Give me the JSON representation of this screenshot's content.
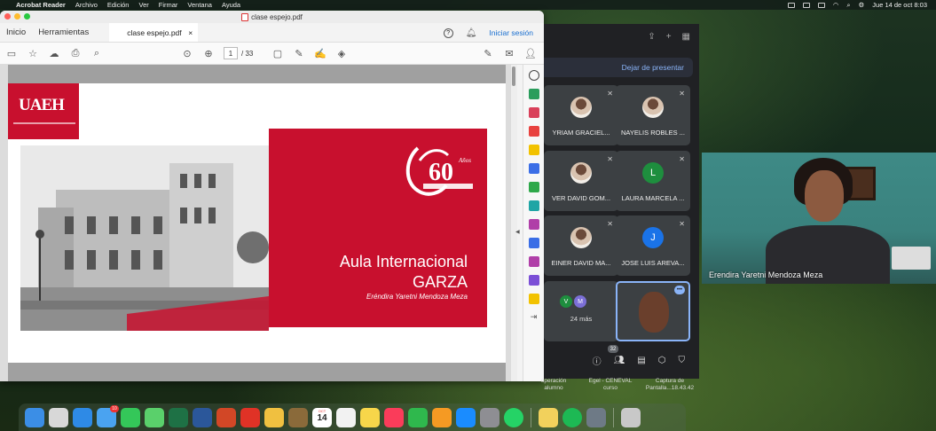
{
  "menubar": {
    "app": "Acrobat Reader",
    "menus": [
      "Archivo",
      "Edición",
      "Ver",
      "Firmar",
      "Ventana",
      "Ayuda"
    ],
    "clock": "Jue 14 de oct  8:03"
  },
  "acrobat": {
    "window_title": "clase espejo.pdf",
    "nav": [
      "Inicio",
      "Herramientas"
    ],
    "doc_tab": "clase espejo.pdf",
    "signin": "Iniciar sesión",
    "page_current": "1",
    "page_total": "/ 33"
  },
  "slide": {
    "logo_text": "UAEH",
    "sixty_text": "60",
    "anos": "Años",
    "title_line1": "Aula Internacional",
    "title_line2": "GARZA",
    "author": "Eréndira Yaretni Mendoza Meza"
  },
  "meet": {
    "stop_presenting": "Dejar de presentar",
    "participants": [
      {
        "name": "YRIAM GRACIEL...",
        "avatar": "photo",
        "color": "#3c4043"
      },
      {
        "name": "NAYELIS ROBLES ...",
        "avatar": "photo",
        "color": "#3c4043"
      },
      {
        "name": "VER DAVID GOM...",
        "avatar": "photo",
        "color": "#3c4043"
      },
      {
        "name": "LAURA MARCELA ...",
        "avatar": "L",
        "color": "#1e8e3e"
      },
      {
        "name": "EINER DAVID MA...",
        "avatar": "photo",
        "color": "#3c4043"
      },
      {
        "name": "JOSE LUIS AREVA...",
        "avatar": "J",
        "color": "#1a73e8"
      }
    ],
    "more": {
      "avatars": [
        "V",
        "M"
      ],
      "label": "24 más"
    },
    "participant_count": "32"
  },
  "webcam": {
    "name": "Erendira Yaretni Mendoza Meza"
  },
  "desktop_labels": [
    {
      "text": "operación\nalumno"
    },
    {
      "text": "Egel - CENEVAL\ncurso"
    },
    {
      "text": "Captura de\nPantalla...18.43.42"
    }
  ],
  "dock": {
    "mail_badge": "10",
    "calendar_month": "OCT",
    "calendar_day": "14",
    "apps": [
      {
        "name": "finder",
        "color": "#3b8ee6"
      },
      {
        "name": "launchpad",
        "color": "#d8d8d8"
      },
      {
        "name": "safari",
        "color": "#2e8ae6"
      },
      {
        "name": "mail",
        "color": "#4aa3f0"
      },
      {
        "name": "facetime",
        "color": "#34c759"
      },
      {
        "name": "messages",
        "color": "#5ad06b"
      },
      {
        "name": "excel",
        "color": "#1e7145"
      },
      {
        "name": "word",
        "color": "#2b579a"
      },
      {
        "name": "powerpoint",
        "color": "#d24726"
      },
      {
        "name": "acrobat",
        "color": "#e03226"
      },
      {
        "name": "photos",
        "color": "#f0c040"
      },
      {
        "name": "app-brown",
        "color": "#8a6a3a"
      },
      {
        "name": "calendar",
        "color": "#ffffff"
      },
      {
        "name": "reminders",
        "color": "#f2f2f2"
      },
      {
        "name": "notes",
        "color": "#f7d64a"
      },
      {
        "name": "music",
        "color": "#fa3c5a"
      },
      {
        "name": "numbers",
        "color": "#2fb84d"
      },
      {
        "name": "pages",
        "color": "#f59a23"
      },
      {
        "name": "app-store",
        "color": "#1a8cff"
      },
      {
        "name": "system-preferences",
        "color": "#8e8e93"
      },
      {
        "name": "whatsapp",
        "color": "#25d366"
      },
      {
        "name": "notes-2",
        "color": "#f2d15c"
      },
      {
        "name": "spotify",
        "color": "#1db954"
      },
      {
        "name": "preview",
        "color": "#6e7a86"
      },
      {
        "name": "trash",
        "color": "#c8c8c8"
      }
    ]
  },
  "colors": {
    "uaeh_red": "#c8102e",
    "meet_bg": "#202124",
    "link_blue": "#1a6fd0"
  }
}
